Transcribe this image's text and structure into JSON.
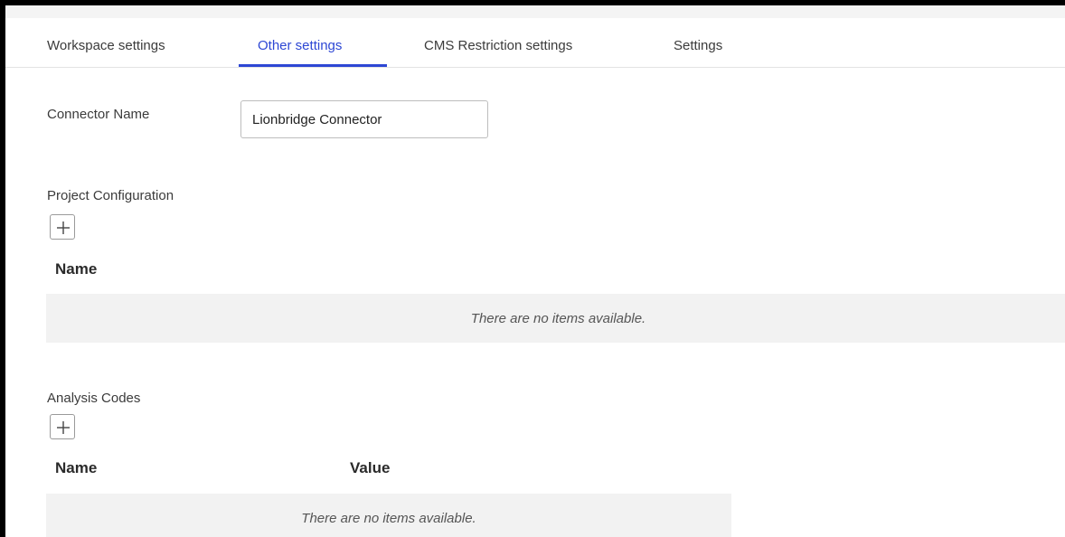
{
  "tabs": [
    {
      "label": "Workspace settings",
      "active": false
    },
    {
      "label": "Other settings",
      "active": true
    },
    {
      "label": "CMS Restriction settings",
      "active": false
    },
    {
      "label": "Settings",
      "active": false
    }
  ],
  "connector": {
    "label": "Connector Name",
    "value": "Lionbridge Connector"
  },
  "project_configuration": {
    "title": "Project Configuration",
    "columns": [
      "Name"
    ],
    "empty_text": "There are no items available."
  },
  "analysis_codes": {
    "title": "Analysis Codes",
    "columns": [
      "Name",
      "Value"
    ],
    "empty_text": "There are no items available."
  },
  "colors": {
    "accent": "#2d47d4",
    "empty_row_bg": "#f2f2f2",
    "border": "#000000"
  },
  "icons": {
    "add": "plus-icon"
  }
}
